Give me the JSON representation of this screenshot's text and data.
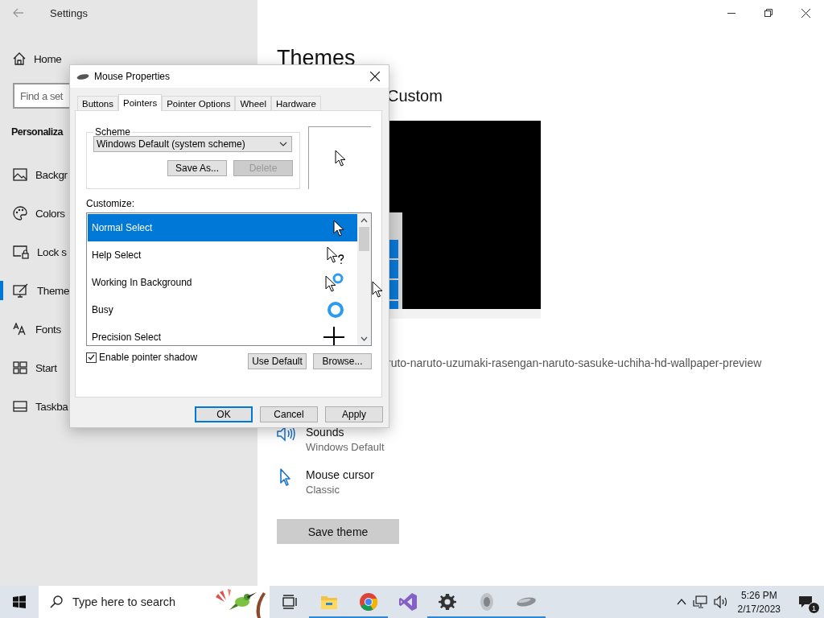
{
  "settings": {
    "title": "Settings",
    "home": "Home",
    "search": {
      "placeholder": "Find a set"
    },
    "section": "Personaliza",
    "nav": [
      {
        "label": "Backgr",
        "selected": false
      },
      {
        "label": "Colors",
        "selected": false
      },
      {
        "label": "Lock s",
        "selected": false
      },
      {
        "label": "Theme",
        "selected": true
      },
      {
        "label": "Fonts",
        "selected": false
      },
      {
        "label": "Start",
        "selected": false
      },
      {
        "label": "Taskba",
        "selected": false
      }
    ]
  },
  "page": {
    "title": "Themes",
    "current": "Custom",
    "background_name": "ruto-naruto-uzumaki-rasengan-naruto-sasuke-uchiha-hd-wallpaper-preview",
    "items": [
      {
        "title": "Sounds",
        "value": "Windows Default"
      },
      {
        "title": "Mouse cursor",
        "value": "Classic"
      }
    ],
    "save_button": "Save theme"
  },
  "dialog": {
    "title": "Mouse Properties",
    "tabs": [
      {
        "label": "Buttons",
        "selected": false
      },
      {
        "label": "Pointers",
        "selected": true
      },
      {
        "label": "Pointer Options",
        "selected": false
      },
      {
        "label": "Wheel",
        "selected": false
      },
      {
        "label": "Hardware",
        "selected": false
      }
    ],
    "scheme": {
      "label": "Scheme",
      "value": "Windows Default (system scheme)",
      "buttons": [
        {
          "label": "Save As...",
          "disabled": false
        },
        {
          "label": "Delete",
          "disabled": true
        }
      ]
    },
    "customize_label": "Customize:",
    "pointers": [
      {
        "label": "Normal Select",
        "selected": true,
        "kind": "arrow"
      },
      {
        "label": "Help Select",
        "selected": false,
        "kind": "help"
      },
      {
        "label": "Working In Background",
        "selected": false,
        "kind": "working"
      },
      {
        "label": "Busy",
        "selected": false,
        "kind": "busy"
      },
      {
        "label": "Precision Select",
        "selected": false,
        "kind": "cross"
      }
    ],
    "shadow": {
      "label": "Enable pointer shadow",
      "checked": true
    },
    "list_buttons": [
      "Use Default",
      "Browse..."
    ],
    "footer_buttons": [
      {
        "label": "OK",
        "default": true
      },
      {
        "label": "Cancel",
        "default": false
      },
      {
        "label": "Apply",
        "default": false
      }
    ]
  },
  "taskbar": {
    "search": {
      "placeholder": "Type here to search"
    },
    "apps": [
      {
        "kind": "task-view",
        "running": false
      },
      {
        "kind": "explorer",
        "running": true
      },
      {
        "kind": "chrome",
        "running": true
      },
      {
        "kind": "studio",
        "running": false
      },
      {
        "kind": "settings",
        "running": true
      },
      {
        "kind": "speaker",
        "running": true
      },
      {
        "kind": "mouse",
        "running": true
      }
    ],
    "clock": {
      "time": "5:26 PM",
      "date": "2/17/2023"
    },
    "notifications": "1"
  }
}
